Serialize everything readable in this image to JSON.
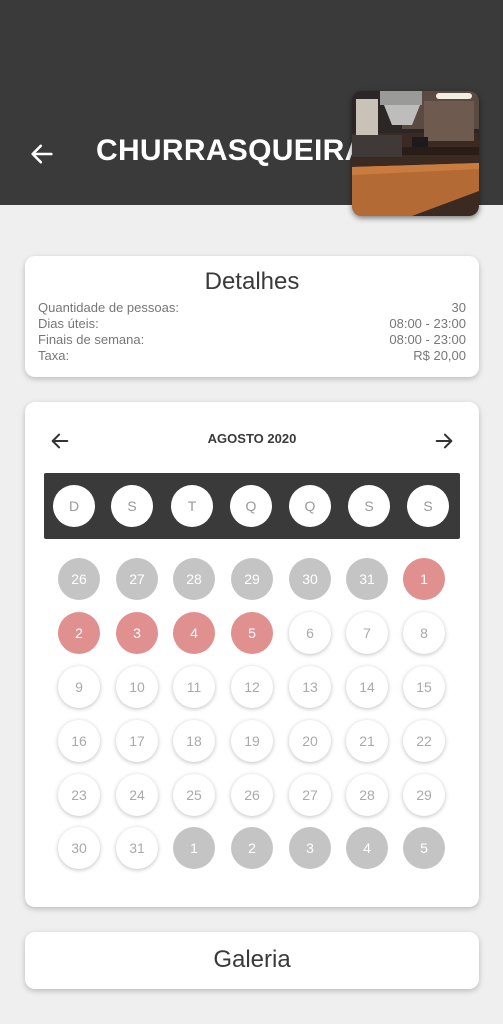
{
  "header": {
    "title": "CHURRASQUEIRA",
    "back_icon": "arrow-left-icon",
    "thumbnail": "barbecue-area-photo"
  },
  "details": {
    "title": "Detalhes",
    "rows": [
      {
        "label": "Quantidade de pessoas:",
        "value": "30"
      },
      {
        "label": "Dias úteis:",
        "value": "08:00 - 23:00"
      },
      {
        "label": "Finais de semana:",
        "value": "08:00 - 23:00"
      },
      {
        "label": "Taxa:",
        "value": "R$  20,00"
      }
    ]
  },
  "calendar": {
    "month": "AGOSTO 2020",
    "prev_icon": "arrow-left-icon",
    "next_icon": "arrow-right-icon",
    "weekdays": [
      "D",
      "S",
      "T",
      "Q",
      "Q",
      "S",
      "S"
    ],
    "days": [
      {
        "n": "26",
        "state": "gray"
      },
      {
        "n": "27",
        "state": "gray"
      },
      {
        "n": "28",
        "state": "gray"
      },
      {
        "n": "29",
        "state": "gray"
      },
      {
        "n": "30",
        "state": "gray"
      },
      {
        "n": "31",
        "state": "gray"
      },
      {
        "n": "1",
        "state": "red"
      },
      {
        "n": "2",
        "state": "red"
      },
      {
        "n": "3",
        "state": "red"
      },
      {
        "n": "4",
        "state": "red"
      },
      {
        "n": "5",
        "state": "red"
      },
      {
        "n": "6",
        "state": "white"
      },
      {
        "n": "7",
        "state": "white"
      },
      {
        "n": "8",
        "state": "white"
      },
      {
        "n": "9",
        "state": "white"
      },
      {
        "n": "10",
        "state": "white"
      },
      {
        "n": "11",
        "state": "white"
      },
      {
        "n": "12",
        "state": "white"
      },
      {
        "n": "13",
        "state": "white"
      },
      {
        "n": "14",
        "state": "white"
      },
      {
        "n": "15",
        "state": "white"
      },
      {
        "n": "16",
        "state": "white"
      },
      {
        "n": "17",
        "state": "white"
      },
      {
        "n": "18",
        "state": "white"
      },
      {
        "n": "19",
        "state": "white"
      },
      {
        "n": "20",
        "state": "white"
      },
      {
        "n": "21",
        "state": "white"
      },
      {
        "n": "22",
        "state": "white"
      },
      {
        "n": "23",
        "state": "white"
      },
      {
        "n": "24",
        "state": "white"
      },
      {
        "n": "25",
        "state": "white"
      },
      {
        "n": "26",
        "state": "white"
      },
      {
        "n": "27",
        "state": "white"
      },
      {
        "n": "28",
        "state": "white"
      },
      {
        "n": "29",
        "state": "white"
      },
      {
        "n": "30",
        "state": "white"
      },
      {
        "n": "31",
        "state": "white"
      },
      {
        "n": "1",
        "state": "gray"
      },
      {
        "n": "2",
        "state": "gray"
      },
      {
        "n": "3",
        "state": "gray"
      },
      {
        "n": "4",
        "state": "gray"
      },
      {
        "n": "5",
        "state": "gray"
      }
    ]
  },
  "gallery": {
    "label": "Galeria"
  },
  "colors": {
    "header_bg": "#3a3a3a",
    "booked": "#e19090",
    "out_of_month": "#c4c4c4",
    "background": "#efefef"
  }
}
